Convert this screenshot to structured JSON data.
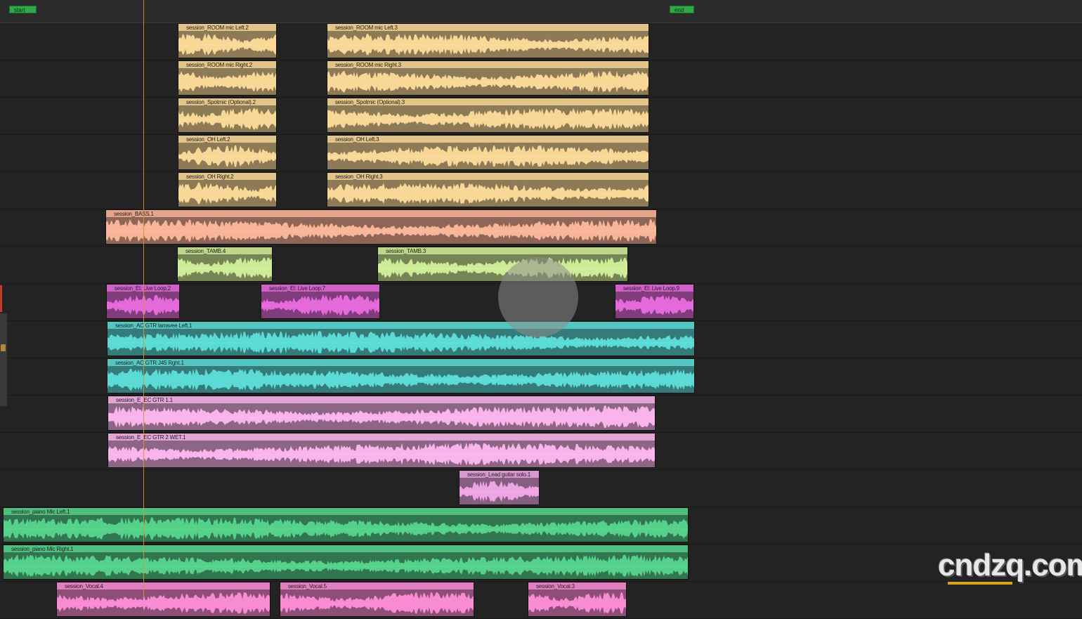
{
  "markers": {
    "start": "start",
    "end": "end"
  },
  "watermark": "cndzq.com",
  "tracks": [
    {
      "regions": [
        {
          "name": "session_ROOM mic Left.2",
          "color": "#e3c48a"
        },
        {
          "name": "session_ROOM mic Left.3",
          "color": "#e3c48a"
        }
      ]
    },
    {
      "regions": [
        {
          "name": "session_ROOM mic Right.2",
          "color": "#e3c48a"
        },
        {
          "name": "session_ROOM mic Right.3",
          "color": "#e3c48a"
        }
      ]
    },
    {
      "regions": [
        {
          "name": "session_Spotmic (Optional).2",
          "color": "#e3c48a"
        },
        {
          "name": "session_Spotmic (Optional).3",
          "color": "#e3c48a"
        }
      ]
    },
    {
      "regions": [
        {
          "name": "session_OH Left.2",
          "color": "#e3c48a"
        },
        {
          "name": "session_OH Left.3",
          "color": "#e3c48a"
        }
      ]
    },
    {
      "regions": [
        {
          "name": "session_OH Right.2",
          "color": "#e3c48a"
        },
        {
          "name": "session_OH Right.3",
          "color": "#e3c48a"
        }
      ]
    },
    {
      "regions": [
        {
          "name": "session_BASS.1",
          "color": "#e4a58c"
        }
      ]
    },
    {
      "regions": [
        {
          "name": "session_TAMB.4",
          "color": "#bcd78a"
        },
        {
          "name": "session_TAMB.3",
          "color": "#bcd78a"
        }
      ]
    },
    {
      "regions": [
        {
          "name": "session_El. Live Loop.2",
          "color": "#d060c8"
        },
        {
          "name": "session_El. Live Loop.7",
          "color": "#d060c8"
        },
        {
          "name": "session_El. Live Loop.9",
          "color": "#d060c8"
        }
      ]
    },
    {
      "regions": [
        {
          "name": "session_AC GTR  larravee Left.1",
          "color": "#55c7c3"
        }
      ]
    },
    {
      "regions": [
        {
          "name": "session_AC GTR J45 Rght.1",
          "color": "#55c7c3"
        }
      ]
    },
    {
      "regions": [
        {
          "name": "session_E_EC GTR 1.1",
          "color": "#e3a4d6"
        }
      ]
    },
    {
      "regions": [
        {
          "name": "session_E_EC GTR 2 WET.1",
          "color": "#e3a4d6"
        }
      ]
    },
    {
      "regions": [
        {
          "name": "session_Lead guitar solo.1",
          "color": "#d897cf"
        }
      ]
    },
    {
      "regions": [
        {
          "name": "session_piano Mic Left.1",
          "color": "#4fbf7f"
        }
      ]
    },
    {
      "regions": [
        {
          "name": "session_piano Mic Right.1",
          "color": "#4fbf7f"
        }
      ]
    },
    {
      "regions": [
        {
          "name": "session_Vocal.4",
          "color": "#e37fc0"
        },
        {
          "name": "session_Vocal.5",
          "color": "#e37fc0"
        },
        {
          "name": "session_Vocal.3",
          "color": "#e37fc0"
        }
      ]
    }
  ]
}
